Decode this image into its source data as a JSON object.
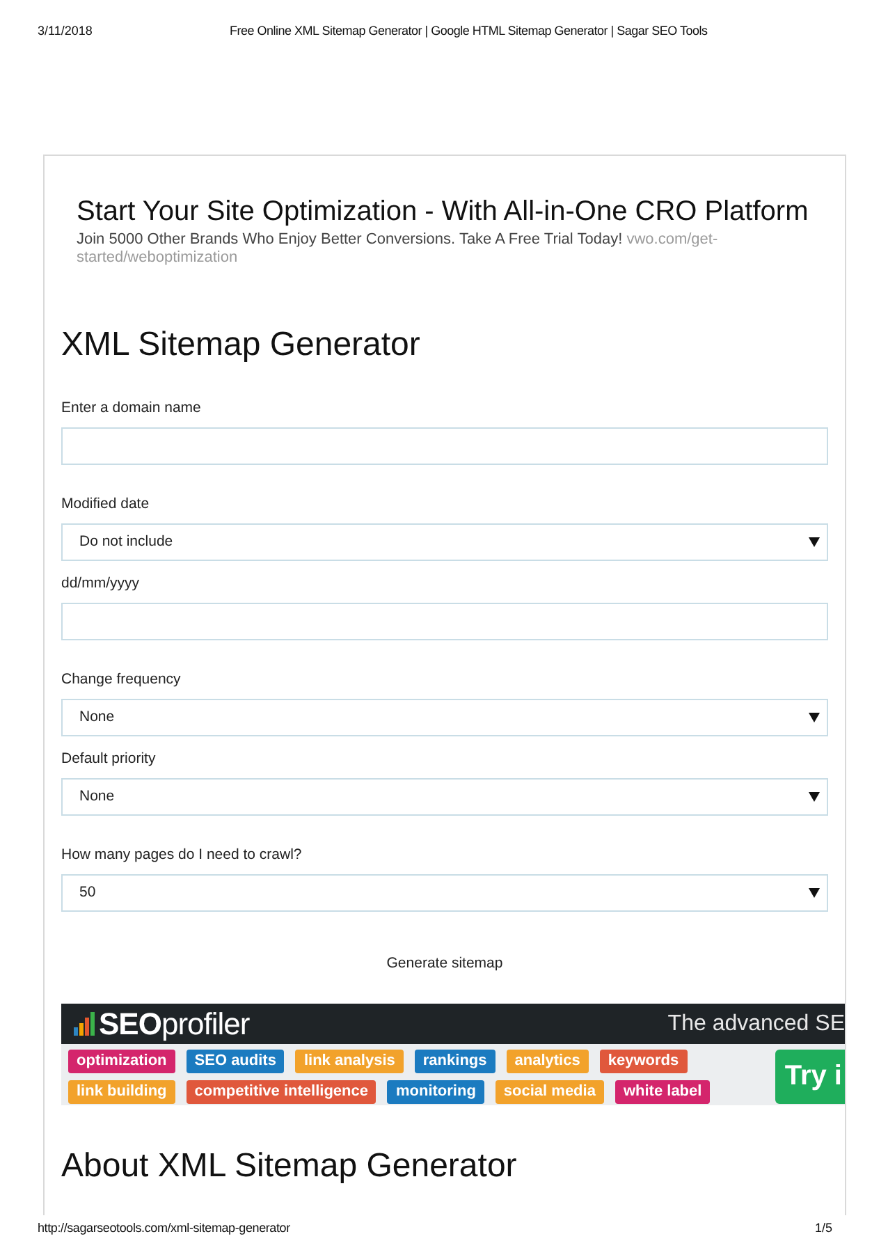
{
  "header": {
    "date": "3/11/2018",
    "title": "Free Online XML Sitemap Generator | Google HTML Sitemap Generator | Sagar SEO Tools"
  },
  "ad": {
    "headline": "Start Your Site Optimization - With All-in-One CRO Platform",
    "description": "Join 5000 Other Brands Who Enjoy Better Conversions. Take A Free Trial Today!",
    "url": "vwo.com/get-started/weboptimization"
  },
  "form": {
    "title": "XML Sitemap Generator",
    "groups": [
      {
        "fields": [
          {
            "kind": "text",
            "label": "Enter a domain name"
          }
        ]
      },
      {
        "fields": [
          {
            "kind": "select",
            "label": "Modified date",
            "value": "Do not include"
          },
          {
            "kind": "text",
            "label": "dd/mm/yyyy"
          }
        ]
      },
      {
        "fields": [
          {
            "kind": "select",
            "label": "Change frequency",
            "value": "None"
          },
          {
            "kind": "select",
            "label": "Default priority",
            "value": "None"
          }
        ]
      },
      {
        "fields": [
          {
            "kind": "select",
            "label": "How many pages do I need to crawl?",
            "value": "50"
          }
        ]
      }
    ],
    "submit": "Generate sitemap"
  },
  "banner": {
    "logo": "**SEO**profiler",
    "tagline": "The advanced SE",
    "tag_rows": [
      [
        {
          "label": "optimization",
          "color": "#d4256c"
        },
        {
          "label": "SEO audits",
          "color": "#1b7bc0"
        },
        {
          "label": "link analysis",
          "color": "#f2a22b"
        },
        {
          "label": "rankings",
          "color": "#1b7bc0"
        },
        {
          "label": "analytics",
          "color": "#f2a22b"
        },
        {
          "label": "keywords",
          "color": "#e0583c"
        }
      ],
      [
        {
          "label": "link building",
          "color": "#f2a22b"
        },
        {
          "label": "competitive intelligence",
          "color": "#e0583c"
        },
        {
          "label": "monitoring",
          "color": "#1b7bc0"
        },
        {
          "label": "social media",
          "color": "#f2a22b"
        },
        {
          "label": "white label",
          "color": "#d4256c"
        }
      ]
    ],
    "cta": "Try i"
  },
  "about": {
    "title": "About XML Sitemap Generator"
  },
  "footer": {
    "url": "http://sagarseotools.com/xml-sitemap-generator",
    "page": "1/5"
  }
}
